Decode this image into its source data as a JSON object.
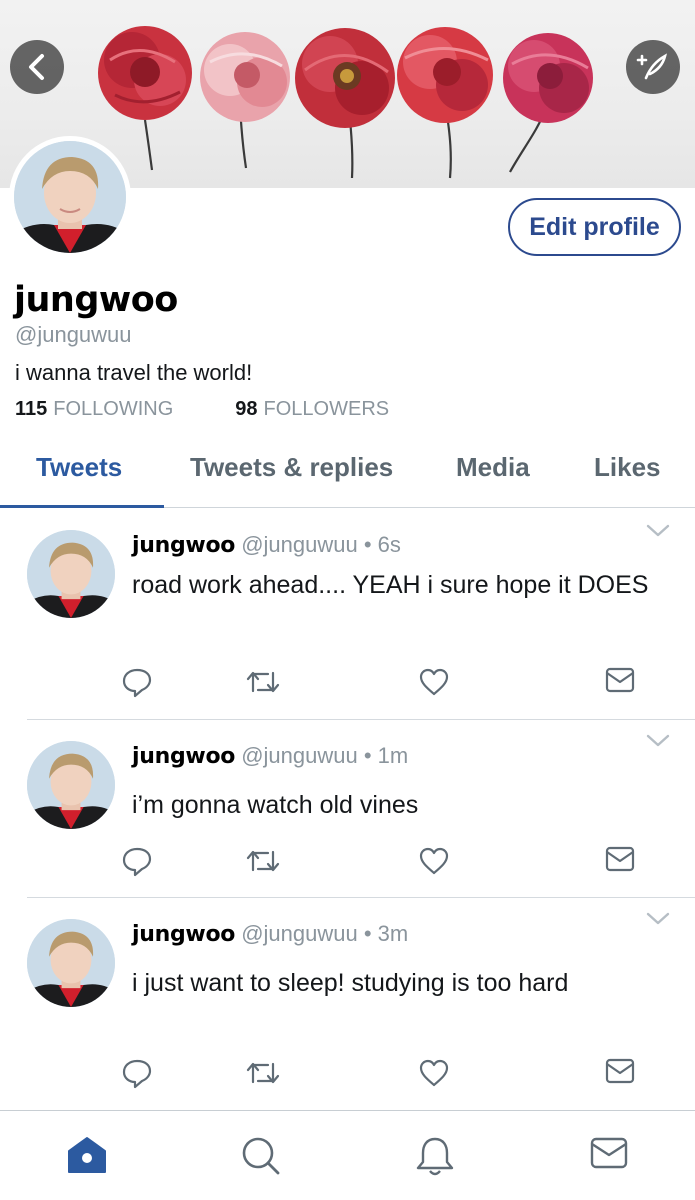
{
  "header": {
    "back_icon": "chevron-left-icon",
    "compose_icon": "feather-plus-icon"
  },
  "profile": {
    "edit_label": "Edit profile",
    "display_name": "jungwoo",
    "handle": "@junguwuu",
    "bio": "i wanna travel the world!",
    "following_count": "115",
    "following_label": "FOLLOWING",
    "followers_count": "98",
    "followers_label": "FOLLOWERS"
  },
  "tabs": [
    {
      "label": "Tweets",
      "active": true
    },
    {
      "label": "Tweets & replies",
      "active": false
    },
    {
      "label": "Media",
      "active": false
    },
    {
      "label": "Likes",
      "active": false
    }
  ],
  "tweets": [
    {
      "name": "jungwoo",
      "handle": "@junguwuu",
      "sep": " • ",
      "time": "6s",
      "text": "road work ahead.... YEAH i sure hope it DOES"
    },
    {
      "name": "jungwoo",
      "handle": "@junguwuu",
      "sep": " • ",
      "time": "1m",
      "text": "i’m gonna watch old vines"
    },
    {
      "name": "jungwoo",
      "handle": "@junguwuu",
      "sep": " • ",
      "time": "3m",
      "text": "i just want to sleep! studying is too hard"
    }
  ],
  "tweet_actions": [
    "reply-icon",
    "retweet-icon",
    "like-icon",
    "message-icon"
  ],
  "bottom_nav": [
    "home-icon",
    "search-icon",
    "notifications-icon",
    "messages-icon"
  ],
  "colors": {
    "accent": "#2c5aa0",
    "edit_border": "#2c4a8e",
    "muted": "#8a949c",
    "icon": "#5f6b75"
  }
}
